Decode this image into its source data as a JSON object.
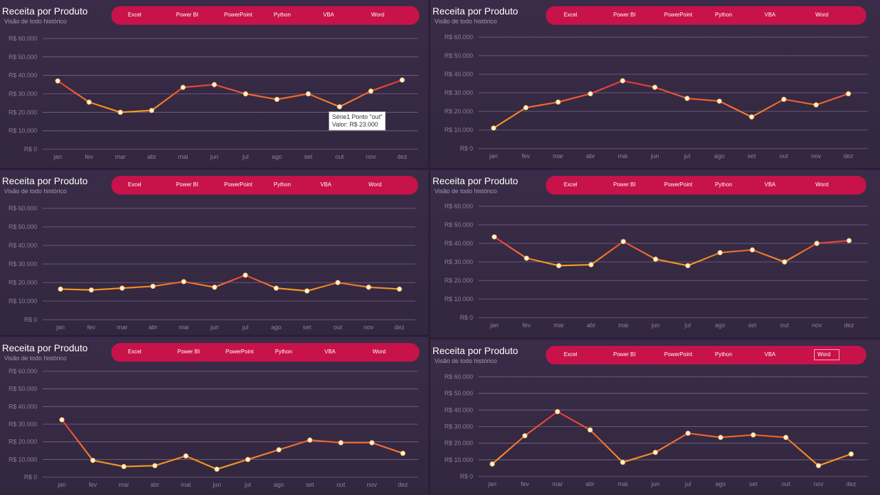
{
  "months": [
    "jan",
    "fev",
    "mar",
    "abr",
    "mai",
    "jun",
    "jul",
    "ago",
    "set",
    "out",
    "nov",
    "dez"
  ],
  "yticks": [
    "R$ 0",
    "R$ 10.000",
    "R$ 20.000",
    "R$ 30.000",
    "R$ 40.000",
    "R$ 50.000",
    "R$ 60.000"
  ],
  "filters": [
    "Excel",
    "Power BI",
    "PowerPoint",
    "Python",
    "VBA",
    "Word"
  ],
  "colors": {
    "background": "#2a1f36",
    "panel": "#3a2c48",
    "filter_bar": "#c8124a",
    "line_start": "#e8323c",
    "line_end": "#f4a020",
    "marker": "#fff3d6",
    "grid": "#7a6a8a"
  },
  "panels": [
    {
      "title": "Receita por Produto",
      "subtitle": "Visão de todo histórico",
      "tooltip": {
        "line1": "Série1 Ponto \"out\"",
        "line2": "Valor: R$ 23.000"
      }
    },
    {
      "title": "Receita por Produto",
      "subtitle": "Visão de todo histórico"
    },
    {
      "title": "Receita por Produto",
      "subtitle": "Visão de todo histórico"
    },
    {
      "title": "Receita por Produto",
      "subtitle": "Visão de todo histórico"
    },
    {
      "title": "Receita por Produto",
      "subtitle": "Visão de todo histórico"
    },
    {
      "title": "Receita por Produto",
      "subtitle": "Visão de todo histórico",
      "selected_filter": "Word"
    }
  ],
  "chart_data": [
    {
      "type": "line",
      "categories": [
        "jan",
        "fev",
        "mar",
        "abr",
        "mai",
        "jun",
        "jul",
        "ago",
        "set",
        "out",
        "nov",
        "dez"
      ],
      "series": [
        {
          "values": [
            37000,
            25500,
            20000,
            21000,
            33500,
            35000,
            30000,
            27000,
            30000,
            23000,
            31500,
            37500
          ]
        }
      ],
      "ylim": [
        0,
        60000
      ],
      "grid": true
    },
    {
      "type": "line",
      "categories": [
        "jan",
        "fev",
        "mar",
        "abr",
        "mai",
        "jun",
        "jul",
        "ago",
        "set",
        "out",
        "nov",
        "dez"
      ],
      "series": [
        {
          "values": [
            11000,
            22000,
            25000,
            29500,
            36500,
            33000,
            27000,
            25500,
            17000,
            26500,
            23500,
            29500
          ]
        }
      ],
      "ylim": [
        0,
        60000
      ],
      "grid": true
    },
    {
      "type": "line",
      "categories": [
        "jan",
        "fev",
        "mar",
        "abr",
        "mai",
        "jun",
        "jul",
        "ago",
        "set",
        "out",
        "nov",
        "dez"
      ],
      "series": [
        {
          "values": [
            16500,
            16000,
            17000,
            18000,
            20500,
            17500,
            24000,
            17000,
            15500,
            20000,
            17500,
            16500
          ]
        }
      ],
      "ylim": [
        0,
        60000
      ],
      "grid": true
    },
    {
      "type": "line",
      "categories": [
        "jan",
        "fev",
        "mar",
        "abr",
        "mai",
        "jun",
        "jul",
        "ago",
        "set",
        "out",
        "nov",
        "dez"
      ],
      "series": [
        {
          "values": [
            43500,
            32000,
            28000,
            28500,
            41000,
            31500,
            28000,
            35000,
            36500,
            30000,
            40000,
            41500
          ]
        }
      ],
      "ylim": [
        0,
        60000
      ],
      "grid": true
    },
    {
      "type": "line",
      "categories": [
        "jan",
        "fev",
        "mar",
        "abr",
        "mai",
        "jun",
        "jul",
        "ago",
        "set",
        "out",
        "nov",
        "dez"
      ],
      "series": [
        {
          "values": [
            32500,
            9500,
            6000,
            6500,
            12000,
            4500,
            10000,
            15500,
            21000,
            19500,
            19500,
            13500
          ]
        }
      ],
      "ylim": [
        0,
        60000
      ],
      "grid": true
    },
    {
      "type": "line",
      "categories": [
        "jan",
        "fev",
        "mar",
        "abr",
        "mai",
        "jun",
        "jul",
        "ago",
        "set",
        "out",
        "nov",
        "dez"
      ],
      "series": [
        {
          "values": [
            7500,
            24500,
            39000,
            28000,
            8500,
            14500,
            26000,
            23500,
            25000,
            23500,
            6500,
            13500
          ]
        }
      ],
      "ylim": [
        0,
        60000
      ],
      "grid": true
    }
  ]
}
